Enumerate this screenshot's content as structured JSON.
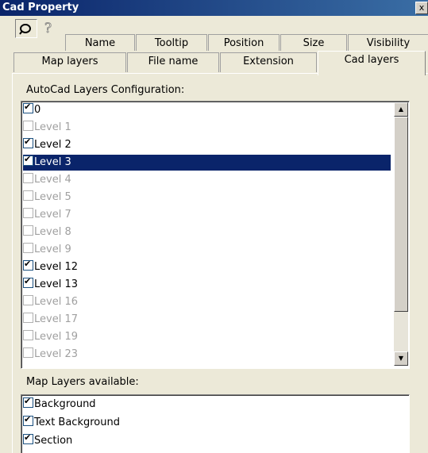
{
  "window": {
    "title": "Cad Property",
    "close_glyph": "x"
  },
  "tabs_row1": [
    {
      "label": "Name"
    },
    {
      "label": "Tooltip"
    },
    {
      "label": "Position"
    },
    {
      "label": "Size"
    },
    {
      "label": "Visibility"
    }
  ],
  "tabs_row2": [
    {
      "label": "Map layers"
    },
    {
      "label": "File name"
    },
    {
      "label": "Extension"
    },
    {
      "label": "Cad layers",
      "active": true
    }
  ],
  "autocad": {
    "label": "AutoCad Layers Configuration:",
    "items": [
      {
        "label": "0",
        "checked": true,
        "enabled": true
      },
      {
        "label": "Level 1",
        "checked": false,
        "enabled": false
      },
      {
        "label": "Level 2",
        "checked": true,
        "enabled": true
      },
      {
        "label": "Level 3",
        "checked": true,
        "enabled": true,
        "selected": true
      },
      {
        "label": "Level 4",
        "checked": false,
        "enabled": false
      },
      {
        "label": "Level 5",
        "checked": false,
        "enabled": false
      },
      {
        "label": "Level 7",
        "checked": false,
        "enabled": false
      },
      {
        "label": "Level 8",
        "checked": false,
        "enabled": false
      },
      {
        "label": "Level 9",
        "checked": false,
        "enabled": false
      },
      {
        "label": "Level 12",
        "checked": true,
        "enabled": true
      },
      {
        "label": "Level 13",
        "checked": true,
        "enabled": true
      },
      {
        "label": "Level 16",
        "checked": false,
        "enabled": false
      },
      {
        "label": "Level 17",
        "checked": false,
        "enabled": false
      },
      {
        "label": "Level 19",
        "checked": false,
        "enabled": false
      },
      {
        "label": "Level 23",
        "checked": false,
        "enabled": false
      }
    ]
  },
  "map_layers": {
    "label": "Map Layers available:",
    "items": [
      {
        "label": "Background",
        "checked": true
      },
      {
        "label": "Text Background",
        "checked": true
      },
      {
        "label": "Section",
        "checked": true
      }
    ]
  },
  "colors": {
    "selection": "#0a246a",
    "disabled_text": "#a0a0a0"
  },
  "icons": [
    "tool-icon",
    "help-icon",
    "scroll-up-icon",
    "scroll-down-icon"
  ]
}
